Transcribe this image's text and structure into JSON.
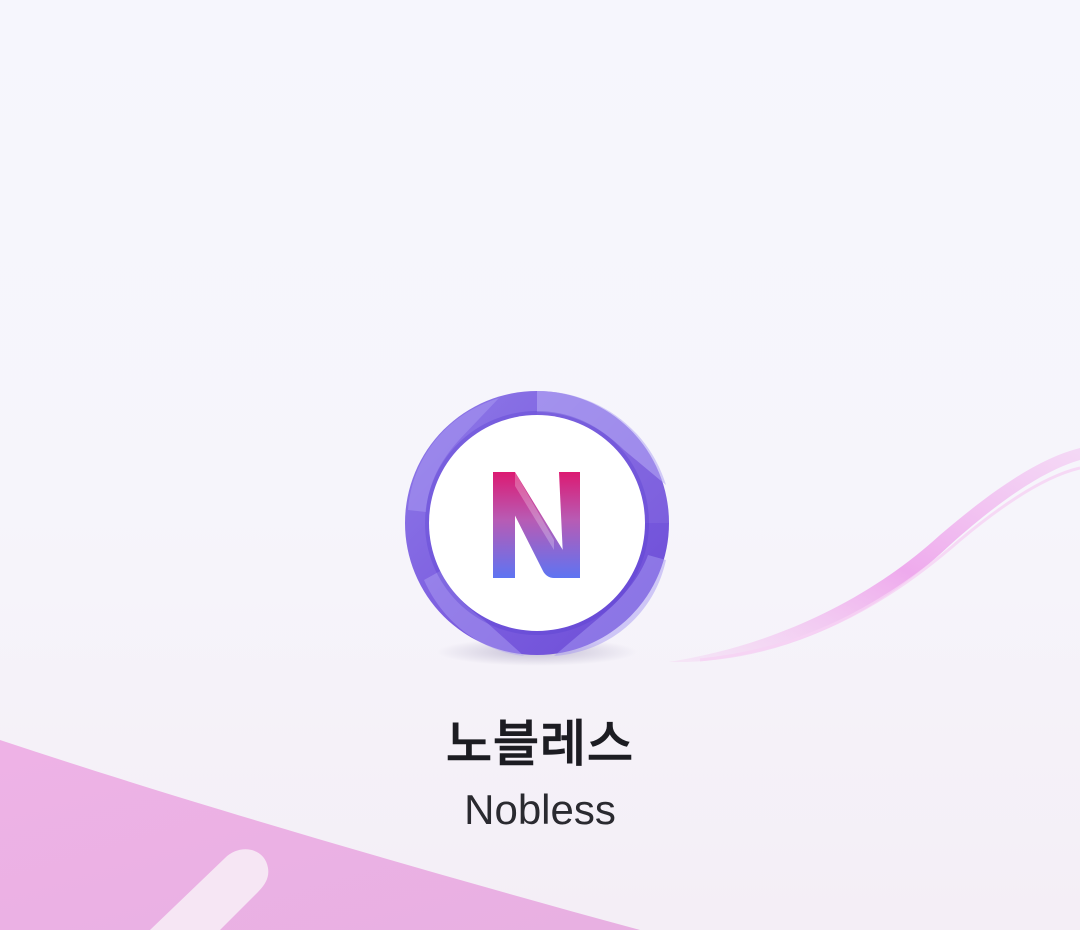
{
  "app": {
    "name_ko": "노블레스",
    "name_en": "Nobless"
  },
  "logo": {
    "letter": "N",
    "icon": "nobless-n-logo-icon"
  },
  "colors": {
    "background": "#f6f6fd",
    "ring_purple": "#7b5be0",
    "ring_light": "#9e8ef0",
    "logo_magenta": "#d81b78",
    "logo_blue": "#6a6ff0",
    "decor_pink": "#eab0e6"
  }
}
